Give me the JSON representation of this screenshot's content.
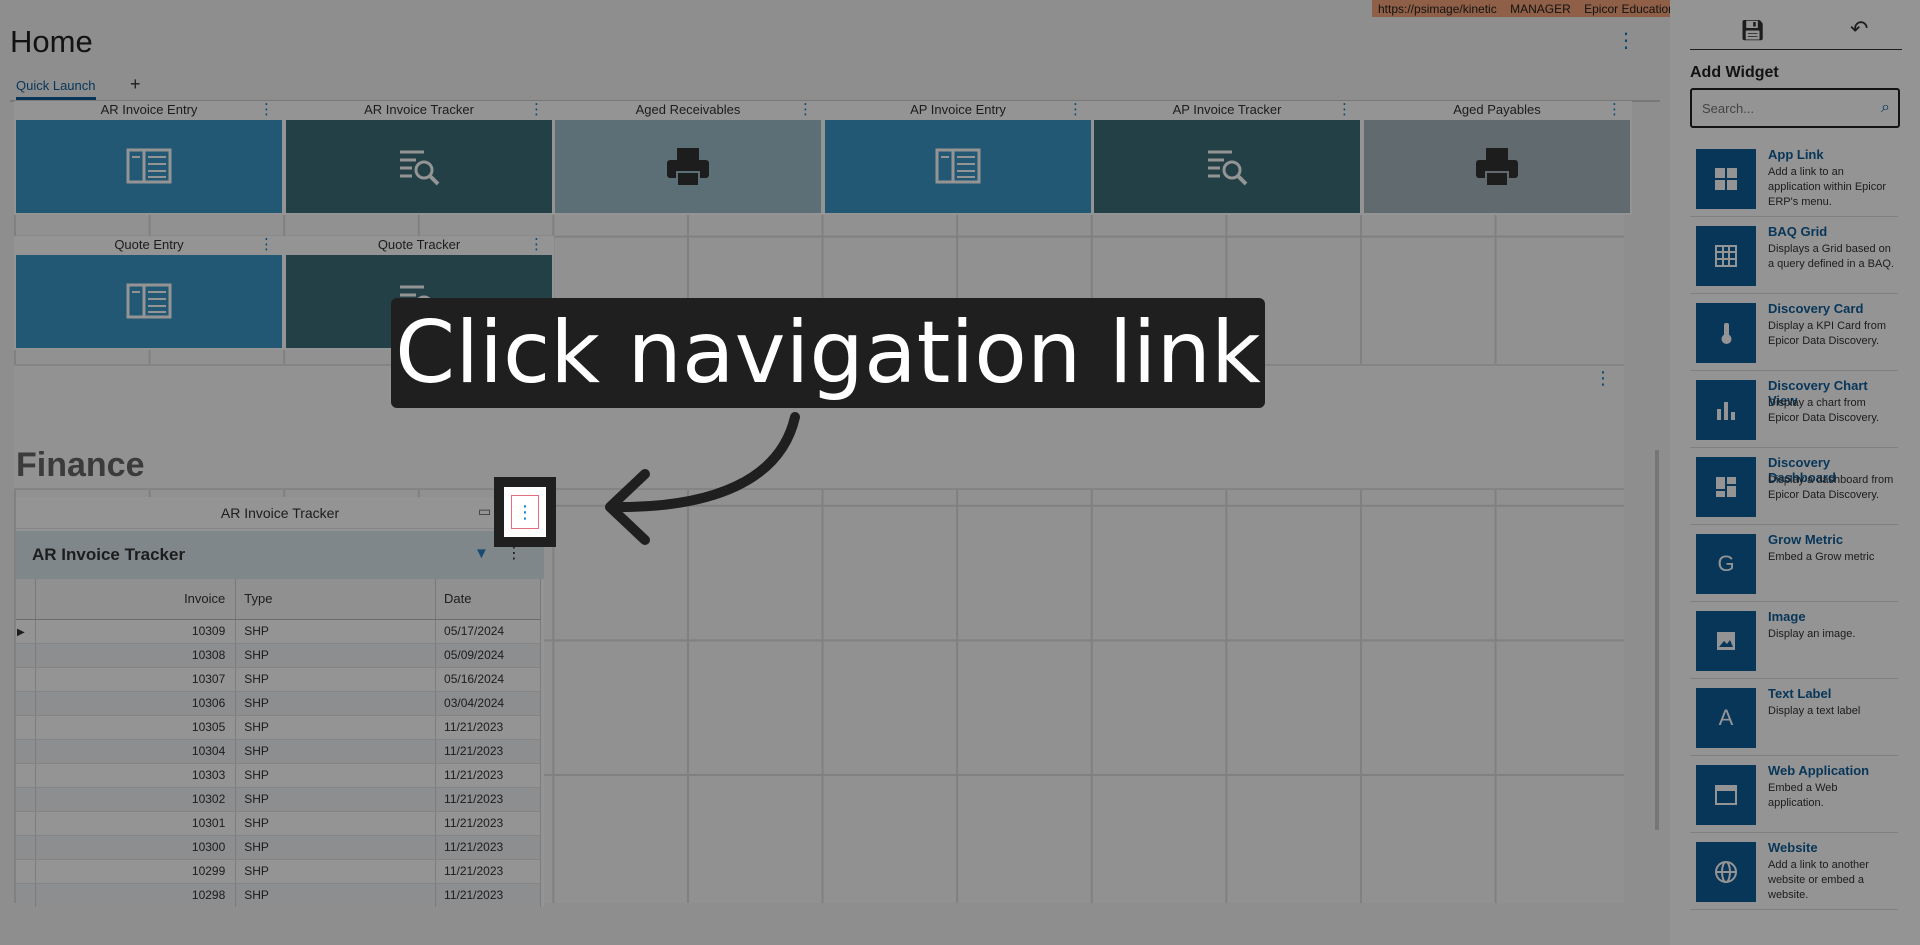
{
  "env_banner": {
    "url": "https://psimage/kinetic",
    "user": "MANAGER",
    "company": "Epicor Education"
  },
  "page": {
    "title": "Home",
    "tab": "Quick Launch",
    "add_tab": "+"
  },
  "tiles": [
    {
      "title": "AR Invoice Entry",
      "style": "blue",
      "icon": "entry-icon"
    },
    {
      "title": "AR Invoice Tracker",
      "style": "dark",
      "icon": "tracker-icon"
    },
    {
      "title": "Aged Receivables",
      "style": "light",
      "icon": "printer-icon"
    },
    {
      "title": "AP Invoice Entry",
      "style": "blue",
      "icon": "entry-icon"
    },
    {
      "title": "AP Invoice Tracker",
      "style": "dark",
      "icon": "tracker-icon"
    },
    {
      "title": "Aged Payables",
      "style": "gray",
      "icon": "printer-icon"
    },
    {
      "title": "Quote Entry",
      "style": "blue",
      "icon": "entry-icon"
    },
    {
      "title": "Quote Tracker",
      "style": "dark",
      "icon": "tracker-icon"
    }
  ],
  "section": {
    "title": "Finance"
  },
  "grid_widget": {
    "header": "AR Invoice Tracker",
    "subtitle": "AR Invoice Tracker",
    "columns": [
      "Invoice",
      "Type",
      "Date"
    ],
    "rows": [
      [
        "10309",
        "SHP",
        "05/17/2024"
      ],
      [
        "10308",
        "SHP",
        "05/09/2024"
      ],
      [
        "10307",
        "SHP",
        "05/16/2024"
      ],
      [
        "10306",
        "SHP",
        "03/04/2024"
      ],
      [
        "10305",
        "SHP",
        "11/21/2023"
      ],
      [
        "10304",
        "SHP",
        "11/21/2023"
      ],
      [
        "10303",
        "SHP",
        "11/21/2023"
      ],
      [
        "10302",
        "SHP",
        "11/21/2023"
      ],
      [
        "10301",
        "SHP",
        "11/21/2023"
      ],
      [
        "10300",
        "SHP",
        "11/21/2023"
      ],
      [
        "10299",
        "SHP",
        "11/21/2023"
      ],
      [
        "10298",
        "SHP",
        "11/21/2023"
      ]
    ]
  },
  "sidebar": {
    "heading": "Add Widget",
    "search_placeholder": "Search...",
    "widgets": [
      {
        "title": "App Link",
        "desc": "Add a link to an application within Epicor ERP's menu.",
        "icon": "grid-icon"
      },
      {
        "title": "BAQ Grid",
        "desc": "Displays a Grid based on a query defined in a BAQ.",
        "icon": "table-icon"
      },
      {
        "title": "Discovery Card",
        "desc": "Display a KPI Card from Epicor Data Discovery.",
        "icon": "thermometer-icon"
      },
      {
        "title": "Discovery Chart View",
        "desc": "Display a chart from Epicor Data Discovery.",
        "icon": "bar-chart-icon"
      },
      {
        "title": "Discovery Dashboard",
        "desc": "Display a dashboard from Epicor Data Discovery.",
        "icon": "dashboard-icon"
      },
      {
        "title": "Grow Metric",
        "desc": "Embed a Grow metric",
        "icon": "grow-icon",
        "glyph": "G"
      },
      {
        "title": "Image",
        "desc": "Display an image.",
        "icon": "image-icon"
      },
      {
        "title": "Text Label",
        "desc": "Display a text label",
        "icon": "text-icon",
        "glyph": "A"
      },
      {
        "title": "Web Application",
        "desc": "Embed a Web application.",
        "icon": "browser-icon"
      },
      {
        "title": "Website",
        "desc": "Add a link to another website or embed a website.",
        "icon": "globe-icon"
      }
    ]
  },
  "callout": {
    "text": "Click navigation link"
  }
}
